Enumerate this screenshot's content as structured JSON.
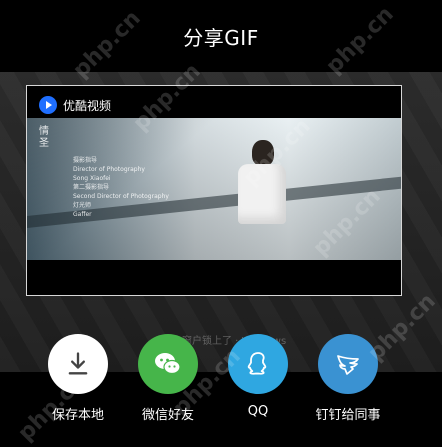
{
  "header": {
    "title": "分享GIF"
  },
  "preview": {
    "brand": "优酷视频",
    "credits": {
      "title": "情\n圣",
      "lines": [
        "摄影指导",
        "Director of Photography",
        "Song Xiaofei",
        "",
        "第二摄影指导",
        "Second Director of Photography",
        "",
        "灯光师",
        "Gaffer"
      ]
    }
  },
  "overlay": {
    "tip": "窗户锁上了 · Windows"
  },
  "share_options": [
    {
      "label": "保存本地",
      "icon": "download-icon",
      "color": "#ffffff"
    },
    {
      "label": "微信好友",
      "icon": "wechat-icon",
      "color": "#46b54a"
    },
    {
      "label": "QQ",
      "icon": "qq-icon",
      "color": "#2fa7e1"
    },
    {
      "label": "钉钉给同事",
      "icon": "dingtalk-icon",
      "color": "#3a92d2"
    }
  ],
  "watermark_text": "php.cn"
}
